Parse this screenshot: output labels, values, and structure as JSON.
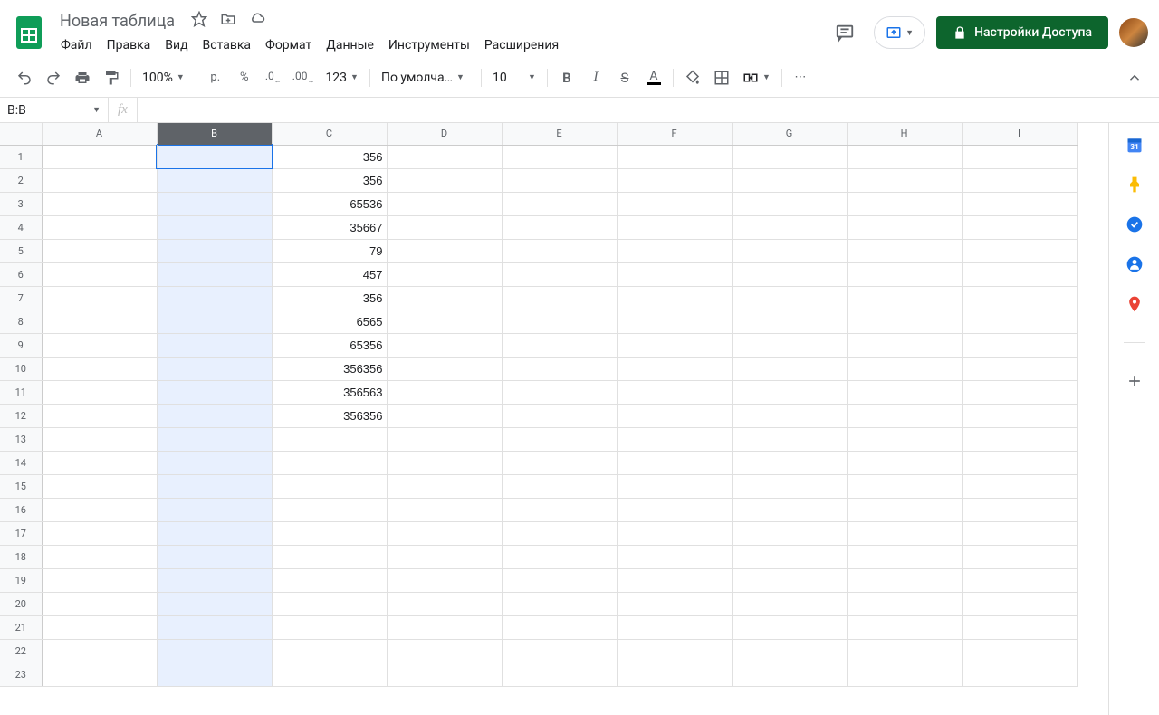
{
  "header": {
    "doc_title": "Новая таблица",
    "share_label": "Настройки Доступа"
  },
  "menu": {
    "items": [
      "Файл",
      "Правка",
      "Вид",
      "Вставка",
      "Формат",
      "Данные",
      "Инструменты",
      "Расширения"
    ]
  },
  "toolbar": {
    "zoom": "100%",
    "currency": "р.",
    "percent": "%",
    "dec_less": ".0",
    "dec_more": ".00",
    "num_format": "123",
    "font": "По умолча…",
    "font_size": "10"
  },
  "formula_bar": {
    "name_box": "B:B",
    "fx": "fx"
  },
  "sheet": {
    "columns": [
      "A",
      "B",
      "C",
      "D",
      "E",
      "F",
      "G",
      "H",
      "I"
    ],
    "row_count": 23,
    "selected_column": "B",
    "active_cell": "B1",
    "data": {
      "C1": "356",
      "C2": "356",
      "C3": "65536",
      "C4": "35667",
      "C5": "79",
      "C6": "457",
      "C7": "356",
      "C8": "6565",
      "C9": "65356",
      "C10": "356356",
      "C11": "356563",
      "C12": "356356"
    }
  },
  "side_panel": {
    "items": [
      "calendar",
      "keep",
      "tasks",
      "contacts",
      "maps",
      "add"
    ]
  }
}
